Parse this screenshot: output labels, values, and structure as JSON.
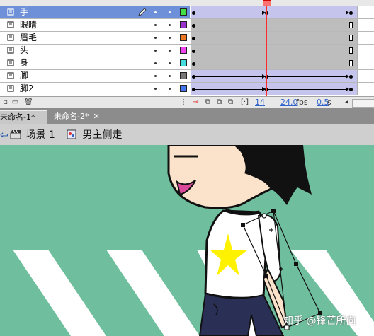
{
  "timeline": {
    "layers": [
      {
        "name": "手",
        "color": "#44dd44",
        "selected": true,
        "tween": true
      },
      {
        "name": "眼睛",
        "color": "#9933cc",
        "selected": false,
        "tween": false
      },
      {
        "name": "眉毛",
        "color": "#ee7722",
        "selected": false,
        "tween": false
      },
      {
        "name": "头",
        "color": "#ee44ee",
        "selected": false,
        "tween": false
      },
      {
        "name": "身",
        "color": "#44dddd",
        "selected": false,
        "tween": false
      },
      {
        "name": "脚",
        "color": "#777777",
        "selected": false,
        "tween": true
      },
      {
        "name": "脚2",
        "color": "#4477ee",
        "selected": false,
        "tween": true
      }
    ],
    "footer": {
      "current_frame": "14",
      "frame_rate": "24.0",
      "frame_rate_unit": "fps",
      "elapsed_time": "0.5",
      "elapsed_unit": "s"
    }
  },
  "document_tabs": [
    {
      "label": "未命名-1*",
      "close": "✕",
      "active": true
    },
    {
      "label": "未命名-2*",
      "close": "✕",
      "active": false
    }
  ],
  "edit_bar": {
    "scene_label": "场景 1",
    "symbol_label": "男主侧走"
  },
  "stage": {
    "background_color": "#6fbf9f",
    "watermark": "知乎 @锋芒所向"
  },
  "icons": [
    "layer-icon",
    "pencil-icon",
    "new-layer-icon",
    "folder-icon",
    "trash-icon",
    "back-arrow-icon",
    "clapper-icon",
    "symbol-icon",
    "onion-skin-icon"
  ]
}
